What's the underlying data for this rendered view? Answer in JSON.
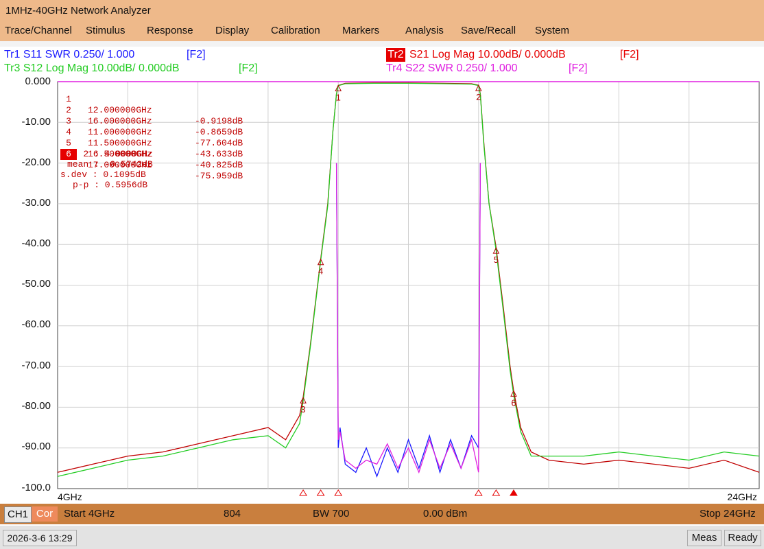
{
  "window": {
    "title": "1MHz-40GHz Network Analyzer"
  },
  "menu": [
    "Trace/Channel",
    "Stimulus",
    "Response",
    "Display",
    "Calibration",
    "Markers",
    "Analysis",
    "Save/Recall",
    "System"
  ],
  "traces": {
    "tr1": {
      "label": "Tr1 S11 SWR 0.250/ 1.000",
      "tag": "[F2]",
      "color": "#1a1aff"
    },
    "tr2": {
      "badge": "Tr2",
      "label": "S21 Log Mag 10.00dB/ 0.000dB",
      "tag": "[F2]",
      "color": "#e60000"
    },
    "tr3": {
      "label": "Tr3 S12 Log Mag 10.00dB/ 0.000dB",
      "tag": "[F2]",
      "color": "#22cc22"
    },
    "tr4": {
      "label": "Tr4 S22 SWR 0.250/ 1.000",
      "tag": "[F2]",
      "color": "#e020e0"
    }
  },
  "y_axis_labels": [
    "0.000",
    "-10.00",
    "-20.00",
    "-30.00",
    "-40.00",
    "-50.00",
    "-60.00",
    "-70.00",
    "-80.00",
    "-90.00",
    "-100.0"
  ],
  "x_axis": {
    "start": "4GHz",
    "stop": "24GHz"
  },
  "markers": [
    {
      "num": "1",
      "freq": "12.000000GHz",
      "value": "-0.9198dB",
      "active": false
    },
    {
      "num": "2",
      "freq": "16.000000GHz",
      "value": "-0.8659dB",
      "active": false
    },
    {
      "num": "3",
      "freq": "11.000000GHz",
      "value": "-77.604dB",
      "active": false
    },
    {
      "num": "4",
      "freq": "11.500000GHz",
      "value": "-43.633dB",
      "active": false
    },
    {
      "num": "5",
      "freq": "16.500000GHz",
      "value": "-40.825dB",
      "active": false
    },
    {
      "num": "6",
      "freq": "17.000000GHz",
      "value": "-75.959dB",
      "active": true
    }
  ],
  "stats": {
    "delta": "1- 2 : 4.0000GHz",
    "mean": "mean : -0.5742dB",
    "sdev": "s.dev : 0.1095dB",
    "pp": "p-p : 0.5956dB"
  },
  "channel": {
    "ch": "CH1",
    "cor": "Cor",
    "start": "Start 4GHz",
    "points": "804",
    "bw": "BW 700",
    "power": "0.00 dBm",
    "stop": "Stop 24GHz"
  },
  "status": {
    "datetime": "2026-3-6 13:29",
    "meas": "Meas",
    "ready": "Ready"
  },
  "chart_data": {
    "type": "line",
    "xlim": [
      4,
      24
    ],
    "ylim": [
      -100,
      0
    ],
    "x_unit": "GHz",
    "y_unit": "dB",
    "grid": true,
    "series": [
      {
        "name": "S21",
        "color": "#c00000",
        "x": [
          4,
          5,
          6,
          7,
          8,
          9,
          10,
          10.5,
          10.9,
          11.0,
          11.2,
          11.5,
          11.7,
          11.85,
          11.95,
          12.0,
          12.2,
          13,
          14,
          15,
          15.8,
          16.0,
          16.05,
          16.15,
          16.3,
          16.5,
          16.7,
          16.9,
          17.0,
          17.2,
          17.5,
          18,
          19,
          20,
          21,
          22,
          23,
          24
        ],
        "y": [
          -96,
          -94,
          -92,
          -91,
          -89,
          -87,
          -85,
          -88,
          -82,
          -77.6,
          -65,
          -43.6,
          -30,
          -12,
          -3,
          -0.92,
          -0.4,
          -0.3,
          -0.3,
          -0.4,
          -0.5,
          -0.87,
          -3,
          -15,
          -30,
          -40.8,
          -55,
          -70,
          -76,
          -85,
          -91,
          -93,
          -94,
          -93,
          -94,
          -95,
          -93,
          -96
        ]
      },
      {
        "name": "S12",
        "color": "#22cc22",
        "x": [
          4,
          5,
          6,
          7,
          8,
          9,
          10,
          10.5,
          10.9,
          11.0,
          11.2,
          11.5,
          11.7,
          11.85,
          11.95,
          12.0,
          12.2,
          13,
          14,
          15,
          15.8,
          16.0,
          16.05,
          16.15,
          16.3,
          16.5,
          16.7,
          16.9,
          17.0,
          17.2,
          17.5,
          18,
          19,
          20,
          21,
          22,
          23,
          24
        ],
        "y": [
          -97,
          -95,
          -93,
          -92,
          -90,
          -88,
          -87,
          -90,
          -84,
          -78.5,
          -65.5,
          -44,
          -30.5,
          -12,
          -3,
          -1.0,
          -0.5,
          -0.4,
          -0.4,
          -0.5,
          -0.6,
          -0.95,
          -3.2,
          -15.5,
          -30,
          -41.5,
          -56,
          -71,
          -77,
          -86,
          -92,
          -92,
          -92,
          -91,
          -92,
          -93,
          -91,
          -92
        ]
      },
      {
        "name": "S11",
        "color": "#1a1aff",
        "x": [
          11.95,
          12.0,
          12.05,
          12.2,
          12.5,
          12.8,
          13.1,
          13.4,
          13.7,
          14.0,
          14.3,
          14.6,
          14.9,
          15.2,
          15.5,
          15.8,
          16.0,
          16.05
        ],
        "y": [
          -20,
          -90,
          -85,
          -94,
          -96,
          -90,
          -97,
          -90,
          -96,
          -88,
          -95,
          -87,
          -96,
          -88,
          -95,
          -87,
          -90,
          -20
        ]
      },
      {
        "name": "S22",
        "color": "#e020e0",
        "x": [
          11.95,
          12.0,
          12.05,
          12.2,
          12.5,
          12.8,
          13.1,
          13.4,
          13.7,
          14.0,
          14.3,
          14.6,
          14.9,
          15.2,
          15.5,
          15.8,
          16.0,
          16.05
        ],
        "y": [
          -20,
          -88,
          -86,
          -93,
          -95,
          -93,
          -94,
          -89,
          -95,
          -90,
          -96,
          -88,
          -95,
          -89,
          -95,
          -88,
          -96,
          -20
        ]
      }
    ]
  }
}
